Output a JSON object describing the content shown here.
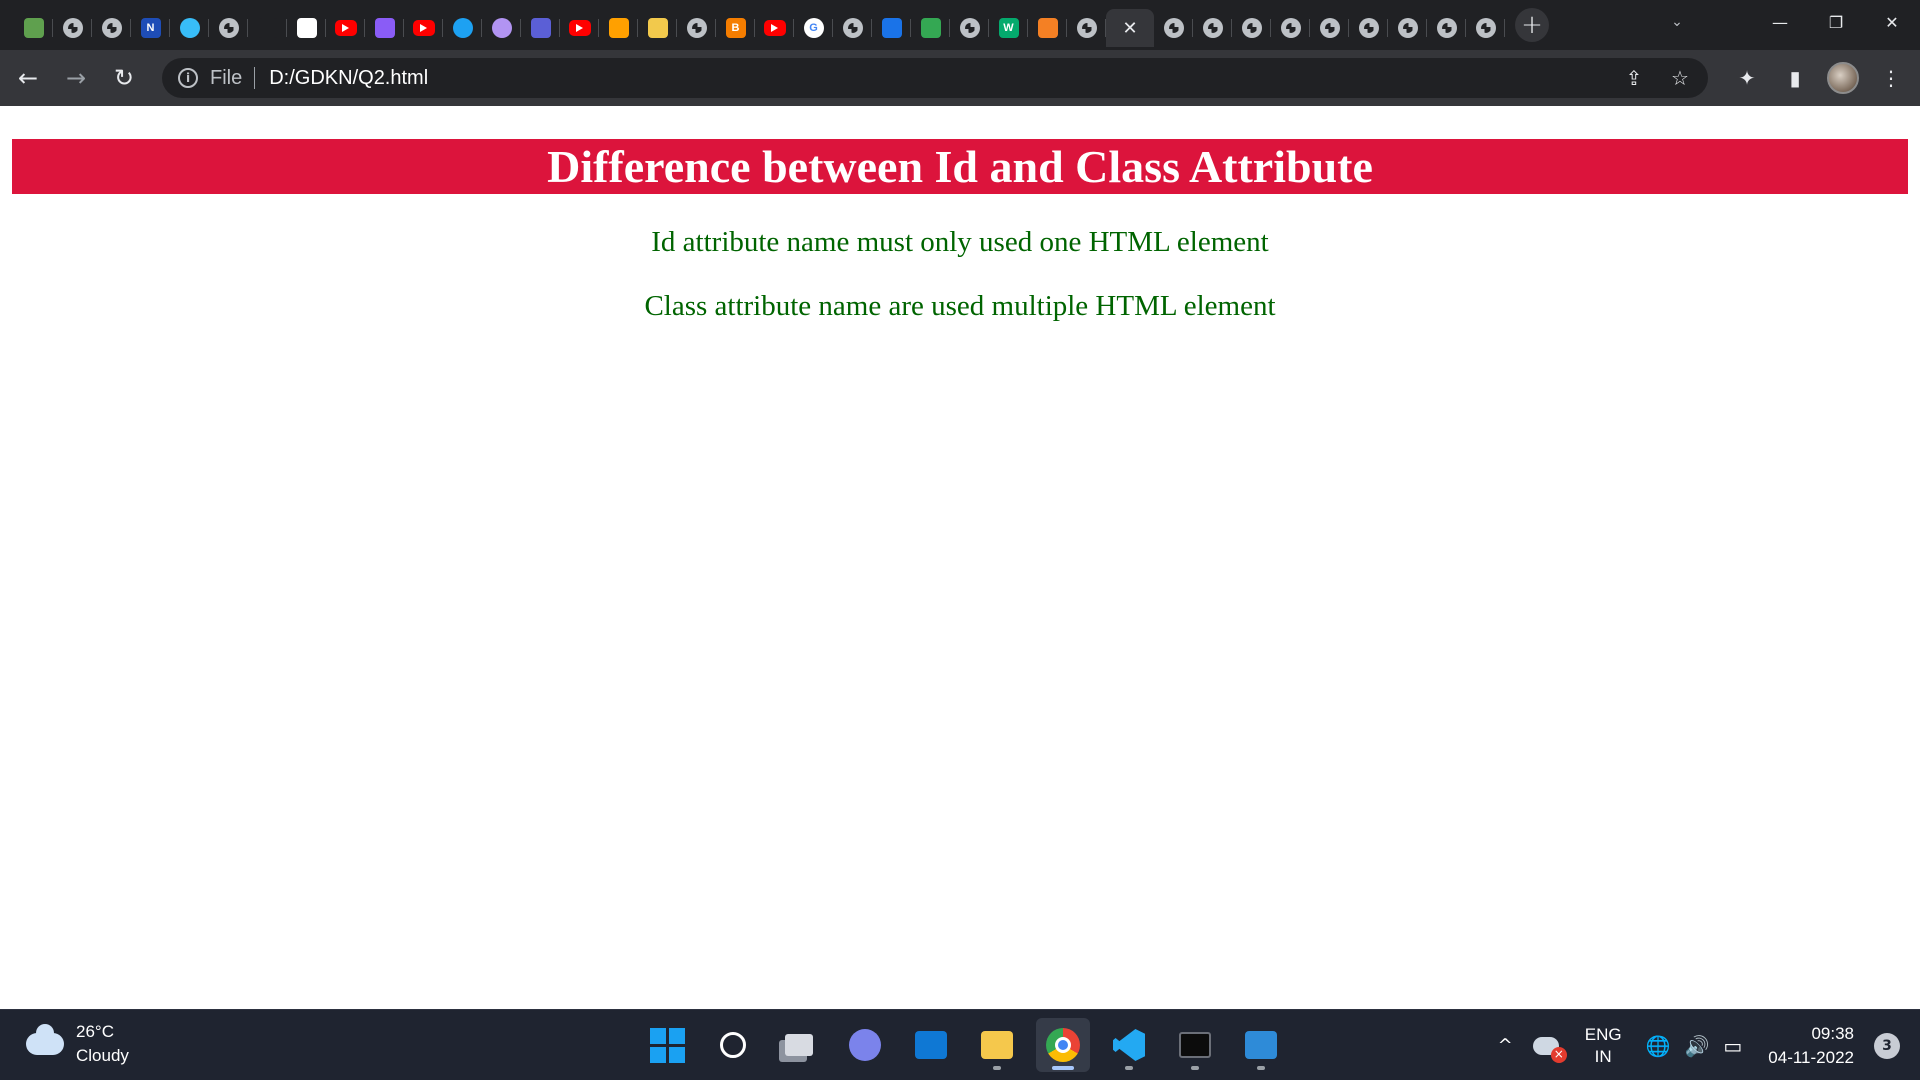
{
  "browser": {
    "tabs": [
      {
        "icon": "node-green-hex-icon",
        "color": "#5fa04e"
      },
      {
        "icon": "globe-icon"
      },
      {
        "icon": "globe-icon"
      },
      {
        "icon": "notion-n-icon",
        "color": "#1e4db7",
        "text": "N"
      },
      {
        "icon": "tailwind-wave-icon",
        "color": "#38bdf8"
      },
      {
        "icon": "globe-icon"
      },
      {
        "icon": "typewriter-icon",
        "color": "#202124"
      },
      {
        "icon": "diamond-grid-icon",
        "color": "#ffffff"
      },
      {
        "icon": "youtube-icon"
      },
      {
        "icon": "knot-icon",
        "color": "#8a5cf6"
      },
      {
        "icon": "youtube-icon"
      },
      {
        "icon": "play-circle-icon",
        "color": "#1da1f2"
      },
      {
        "icon": "orb-icon",
        "color": "#b294f2"
      },
      {
        "icon": "purple-rect-icon",
        "color": "#5b5fd6"
      },
      {
        "icon": "youtube-icon"
      },
      {
        "icon": "firebase-icon",
        "color": "#ffa000"
      },
      {
        "icon": "cup-icon",
        "color": "#f2c94c"
      },
      {
        "icon": "globe-icon"
      },
      {
        "icon": "blogger-icon",
        "color": "#f57d00",
        "text": "B"
      },
      {
        "icon": "youtube-icon"
      },
      {
        "icon": "google-g-icon",
        "color": "#ffffff",
        "text": "G"
      },
      {
        "icon": "globe-icon"
      },
      {
        "icon": "contacts-icon",
        "color": "#1a73e8"
      },
      {
        "icon": "google-drive-icon",
        "color": "#34a853"
      },
      {
        "icon": "globe-icon"
      },
      {
        "icon": "w3schools-icon",
        "color": "#04aa6d",
        "text": "W"
      },
      {
        "icon": "stackoverflow-icon",
        "color": "#f48024"
      },
      {
        "icon": "globe-icon"
      },
      {
        "icon": "close-icon",
        "active": true
      },
      {
        "icon": "globe-icon"
      },
      {
        "icon": "globe-icon"
      },
      {
        "icon": "globe-icon"
      },
      {
        "icon": "globe-icon"
      },
      {
        "icon": "globe-icon"
      },
      {
        "icon": "globe-icon"
      },
      {
        "icon": "globe-icon"
      },
      {
        "icon": "globe-icon"
      },
      {
        "icon": "globe-icon"
      }
    ],
    "new_tab_glyph": "+",
    "tab_search_glyph": "⌄",
    "window": {
      "minimize": "—",
      "restore": "❐",
      "close": "✕"
    },
    "nav": {
      "back": "←",
      "forward": "→",
      "reload": "↻"
    },
    "omnibox": {
      "info_glyph": "i",
      "scheme_label": "File",
      "url": "D:/GDKN/Q2.html",
      "share_glyph": "⇪",
      "bookmark_glyph": "☆"
    },
    "toolbar_right": {
      "extensions_glyph": "✦",
      "sidepanel_glyph": "▮",
      "menu_glyph": "⋮"
    }
  },
  "page": {
    "heading": "Difference between Id and Class Attribute",
    "heading_bg": "#dc143c",
    "text_color": "#006400",
    "paragraphs": [
      "Id attribute name must only used one HTML element",
      "Class attribute name are used multiple HTML element"
    ]
  },
  "taskbar": {
    "weather": {
      "temp": "26°C",
      "condition": "Cloudy"
    },
    "apps": [
      {
        "name": "start-button",
        "icon": "windows-logo-icon"
      },
      {
        "name": "search-button",
        "icon": "search-icon",
        "glyph": "⌕"
      },
      {
        "name": "task-view-button",
        "icon": "task-view-icon"
      },
      {
        "name": "teams-chat-button",
        "icon": "chat-icon",
        "color": "#7b83eb"
      },
      {
        "name": "mail-app",
        "icon": "mail-icon",
        "color": "#0f78d4"
      },
      {
        "name": "file-explorer-app",
        "icon": "folder-icon",
        "color": "#f5c84c",
        "running": true
      },
      {
        "name": "chrome-app",
        "icon": "chrome-icon",
        "active": true
      },
      {
        "name": "vscode-app",
        "icon": "vscode-icon",
        "color": "#23a9f2",
        "running": true
      },
      {
        "name": "terminal-app",
        "icon": "terminal-icon",
        "running": true
      },
      {
        "name": "photos-app",
        "icon": "photos-icon",
        "color": "#2e8bd8",
        "running": true
      }
    ],
    "tray": {
      "chevron": "^",
      "lang_top": "ENG",
      "lang_bottom": "IN",
      "network_glyph": "🌐",
      "volume_glyph": "🔊",
      "battery_glyph": "▭",
      "time": "09:38",
      "date": "04-11-2022",
      "notifications": "3"
    }
  }
}
